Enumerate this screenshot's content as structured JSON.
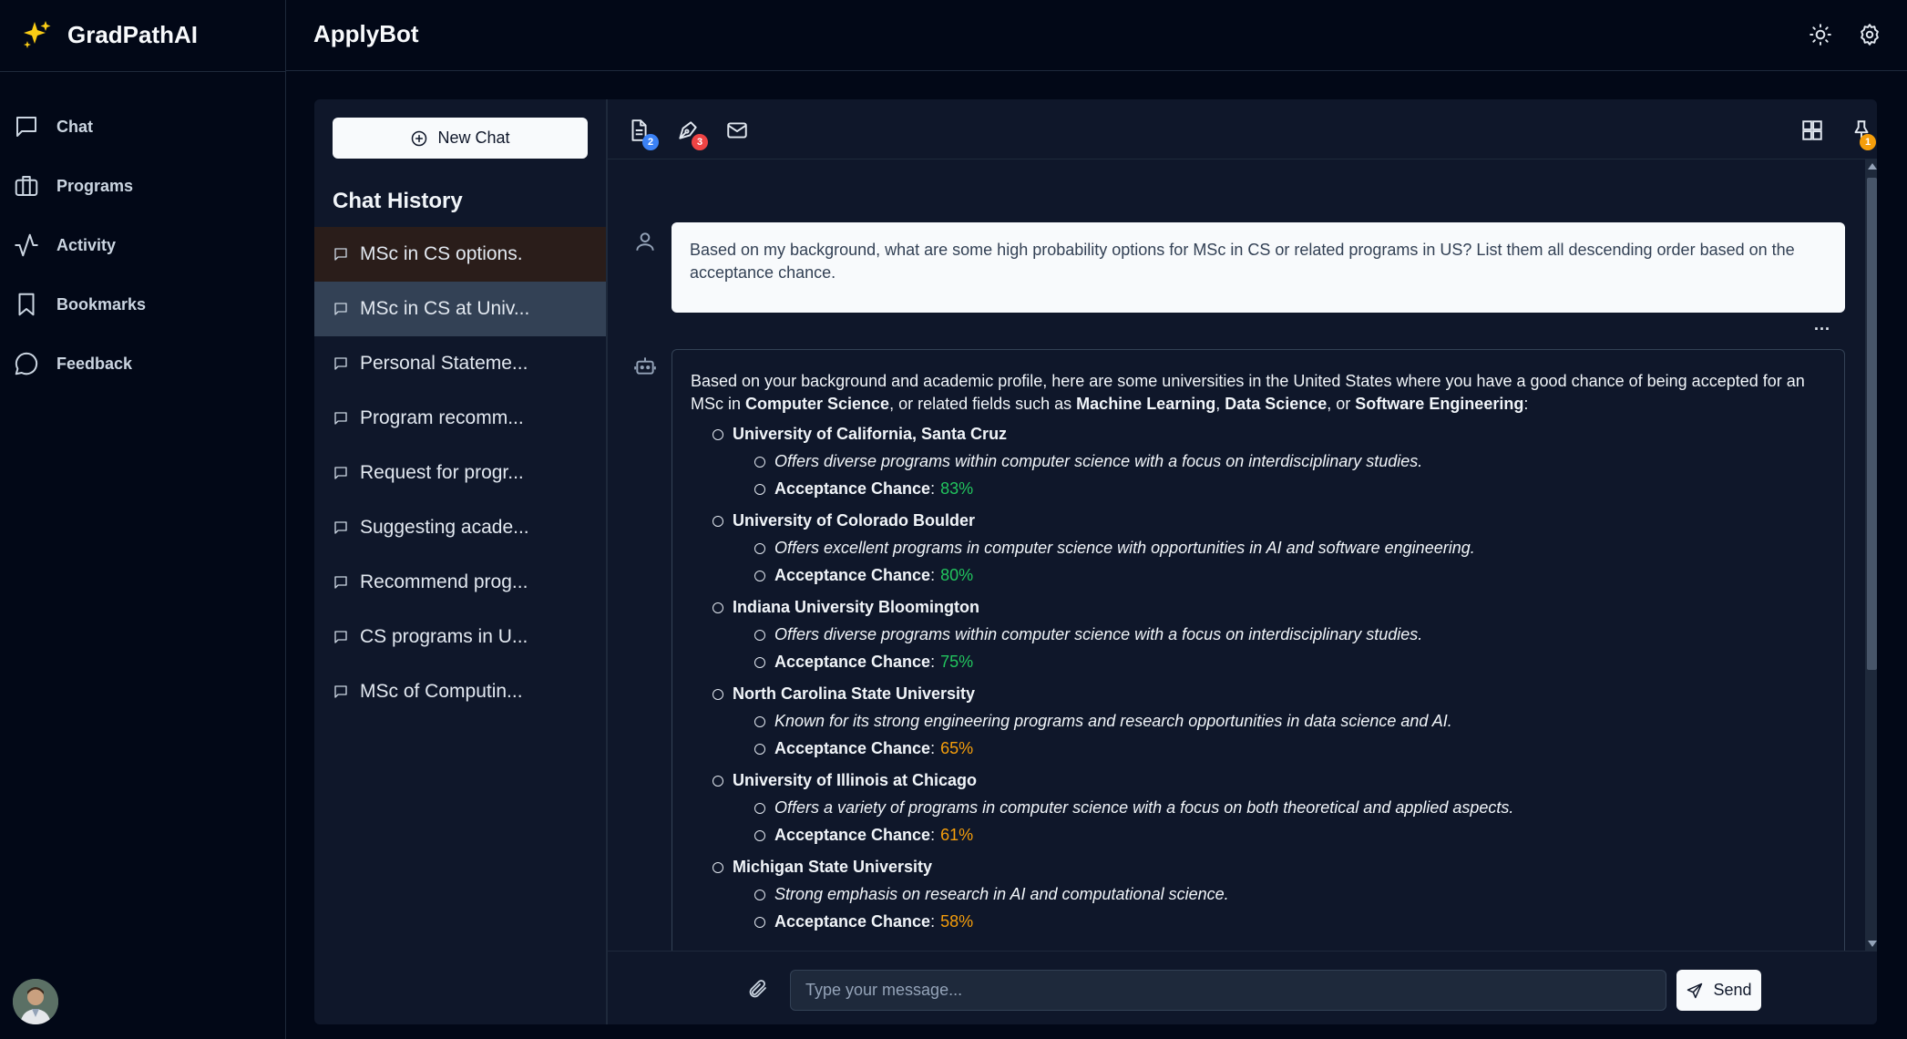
{
  "brand": {
    "name": "GradPathAI",
    "accent": "#facc15"
  },
  "nav": {
    "items": [
      {
        "label": "Chat",
        "icon": "chat-bubble-icon"
      },
      {
        "label": "Programs",
        "icon": "briefcase-icon"
      },
      {
        "label": "Activity",
        "icon": "activity-icon"
      },
      {
        "label": "Bookmarks",
        "icon": "bookmark-icon"
      },
      {
        "label": "Feedback",
        "icon": "message-circle-icon"
      }
    ]
  },
  "header": {
    "title": "ApplyBot",
    "icons": [
      "sun-icon",
      "gear-icon"
    ]
  },
  "history": {
    "new_chat_label": "New Chat",
    "title": "Chat History",
    "items": [
      "MSc in CS options.",
      "MSc in CS at Univ...",
      "Personal Stateme...",
      "Program recomm...",
      "Request for progr...",
      "Suggesting acade...",
      "Recommend prog...",
      "CS programs in U...",
      "MSc of Computin..."
    ]
  },
  "toolbar": {
    "badges": {
      "documents": "2",
      "editor": "3",
      "pin": "1"
    },
    "badge_colors": {
      "documents": "#3b82f6",
      "editor": "#ef4444",
      "pin": "#f59e0b"
    },
    "icons": [
      "document-icon",
      "pen-tool-icon",
      "mail-icon",
      "grid-icon",
      "pin-icon"
    ]
  },
  "conversation": {
    "user_message": "Based on my background, what are some high probability options for MSc in CS or related programs in US? List them all descending order based on the acceptance chance.",
    "bot_intro": {
      "t1": "Based on your background and academic profile, here are some universities in the United States where you have a good chance of being accepted for an MSc in ",
      "b1": "Computer Science",
      "t2": ", or related fields such as ",
      "b2": "Machine Learning",
      "t3": ", ",
      "b3": "Data Science",
      "t4": ", or ",
      "b4": "Software Engineering",
      "t5": ":"
    },
    "chance_label": "Acceptance Chance",
    "chance_colon": ":",
    "universities": [
      {
        "name": "University of California, Santa Cruz",
        "desc": "Offers diverse programs within computer science with a focus on interdisciplinary studies.",
        "chance": "83%",
        "color": "#22c55e"
      },
      {
        "name": "University of Colorado Boulder",
        "desc": "Offers excellent programs in computer science with opportunities in AI and software engineering.",
        "chance": "80%",
        "color": "#22c55e"
      },
      {
        "name": "Indiana University Bloomington",
        "desc": "Offers diverse programs within computer science with a focus on interdisciplinary studies.",
        "chance": "75%",
        "color": "#22c55e"
      },
      {
        "name": "North Carolina State University",
        "desc": "Known for its strong engineering programs and research opportunities in data science and AI.",
        "chance": "65%",
        "color": "#f59e0b"
      },
      {
        "name": "University of Illinois at Chicago",
        "desc": "Offers a variety of programs in computer science with a focus on both theoretical and applied aspects.",
        "chance": "61%",
        "color": "#f59e0b"
      },
      {
        "name": "Michigan State University",
        "desc": "Strong emphasis on research in AI and computational science.",
        "chance": "58%",
        "color": "#f59e0b"
      }
    ],
    "more_label": "..."
  },
  "composer": {
    "placeholder": "Type your message...",
    "send_label": "Send"
  }
}
